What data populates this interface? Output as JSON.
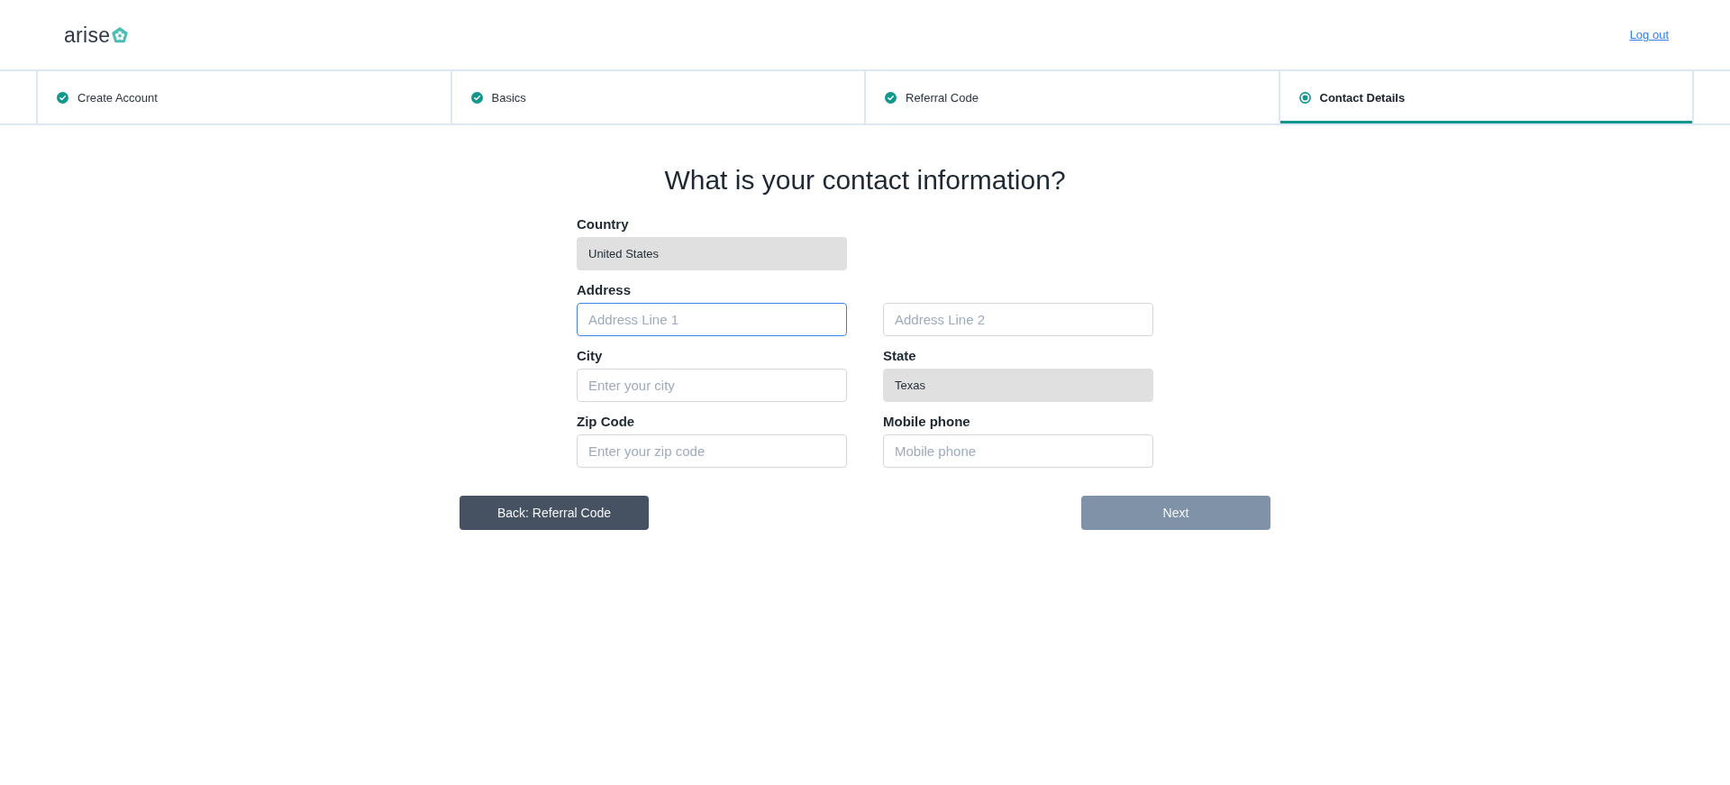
{
  "header": {
    "logo_text": "arise",
    "logout_link": "Log out"
  },
  "steps": [
    {
      "label": "Create Account",
      "completed": true,
      "selected": false
    },
    {
      "label": "Basics",
      "completed": true,
      "selected": false
    },
    {
      "label": "Referral Code",
      "completed": true,
      "selected": false
    },
    {
      "label": "Contact Details",
      "completed": false,
      "selected": true
    }
  ],
  "form": {
    "title": "What is your contact information?",
    "rows": [
      {
        "fields": [
          {
            "label": "Country",
            "value": "United States",
            "disabled": true,
            "focused": false
          }
        ]
      },
      {
        "fields": [
          {
            "label": "Address",
            "placeholder": "Address Line 1",
            "disabled": false,
            "focused": true
          },
          {
            "placeholder": "Address Line 2",
            "disabled": false,
            "focused": false
          }
        ]
      },
      {
        "fields": [
          {
            "label": "City",
            "placeholder": "Enter your city",
            "disabled": false,
            "focused": false
          },
          {
            "label": "State",
            "value": "Texas",
            "disabled": true,
            "focused": false
          }
        ]
      },
      {
        "fields": [
          {
            "label": "Zip Code",
            "placeholder": "Enter your zip code",
            "disabled": false,
            "focused": false
          },
          {
            "label": "Mobile phone",
            "placeholder": "Mobile phone",
            "disabled": false,
            "focused": false
          }
        ]
      }
    ]
  },
  "buttons": [
    {
      "label": "Back: Referral Code",
      "disabled": false
    },
    {
      "label": "Next",
      "disabled": true
    }
  ]
}
